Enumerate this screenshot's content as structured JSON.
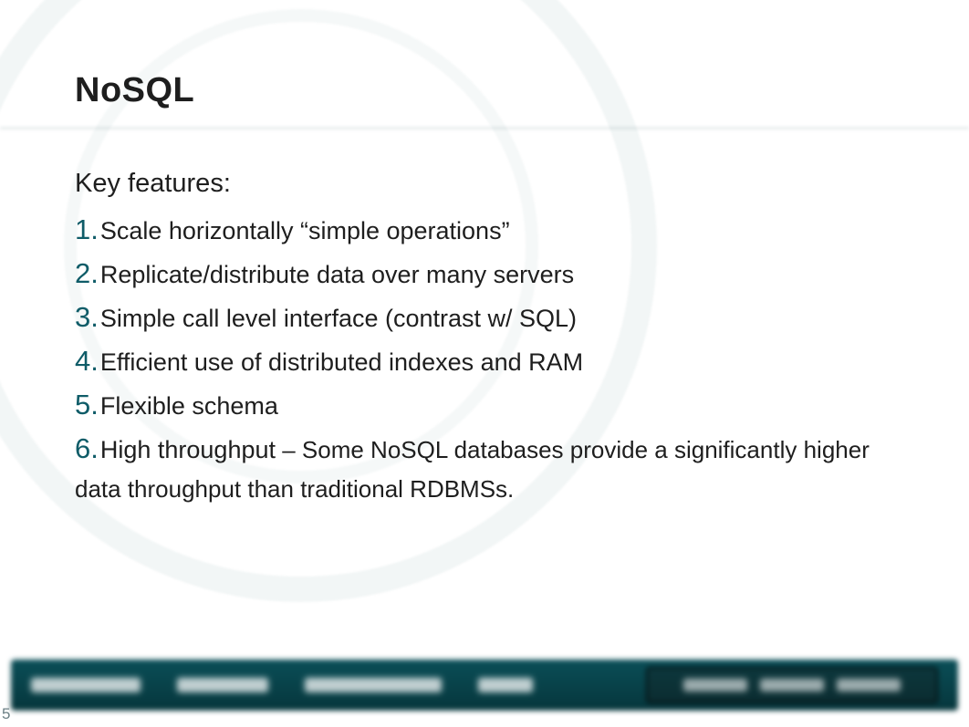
{
  "title": "NoSQL",
  "lead": "Key features:",
  "items": [
    {
      "num": "1.",
      "text": "Scale horizontally “simple operations”"
    },
    {
      "num": "2.",
      "text": "Replicate/distribute data over many servers"
    },
    {
      "num": "3.",
      "text": "Simple call level interface (contrast w/ SQL)"
    },
    {
      "num": "4.",
      "text": "Efficient use of distributed indexes and RAM"
    },
    {
      "num": "5.",
      "text": "Flexible schema"
    },
    {
      "num": "6.",
      "text": "High throughput",
      "detail": " – Some NoSQL databases provide a significantly higher data throughput than traditional RDBMSs."
    }
  ],
  "pageNumber": "5"
}
